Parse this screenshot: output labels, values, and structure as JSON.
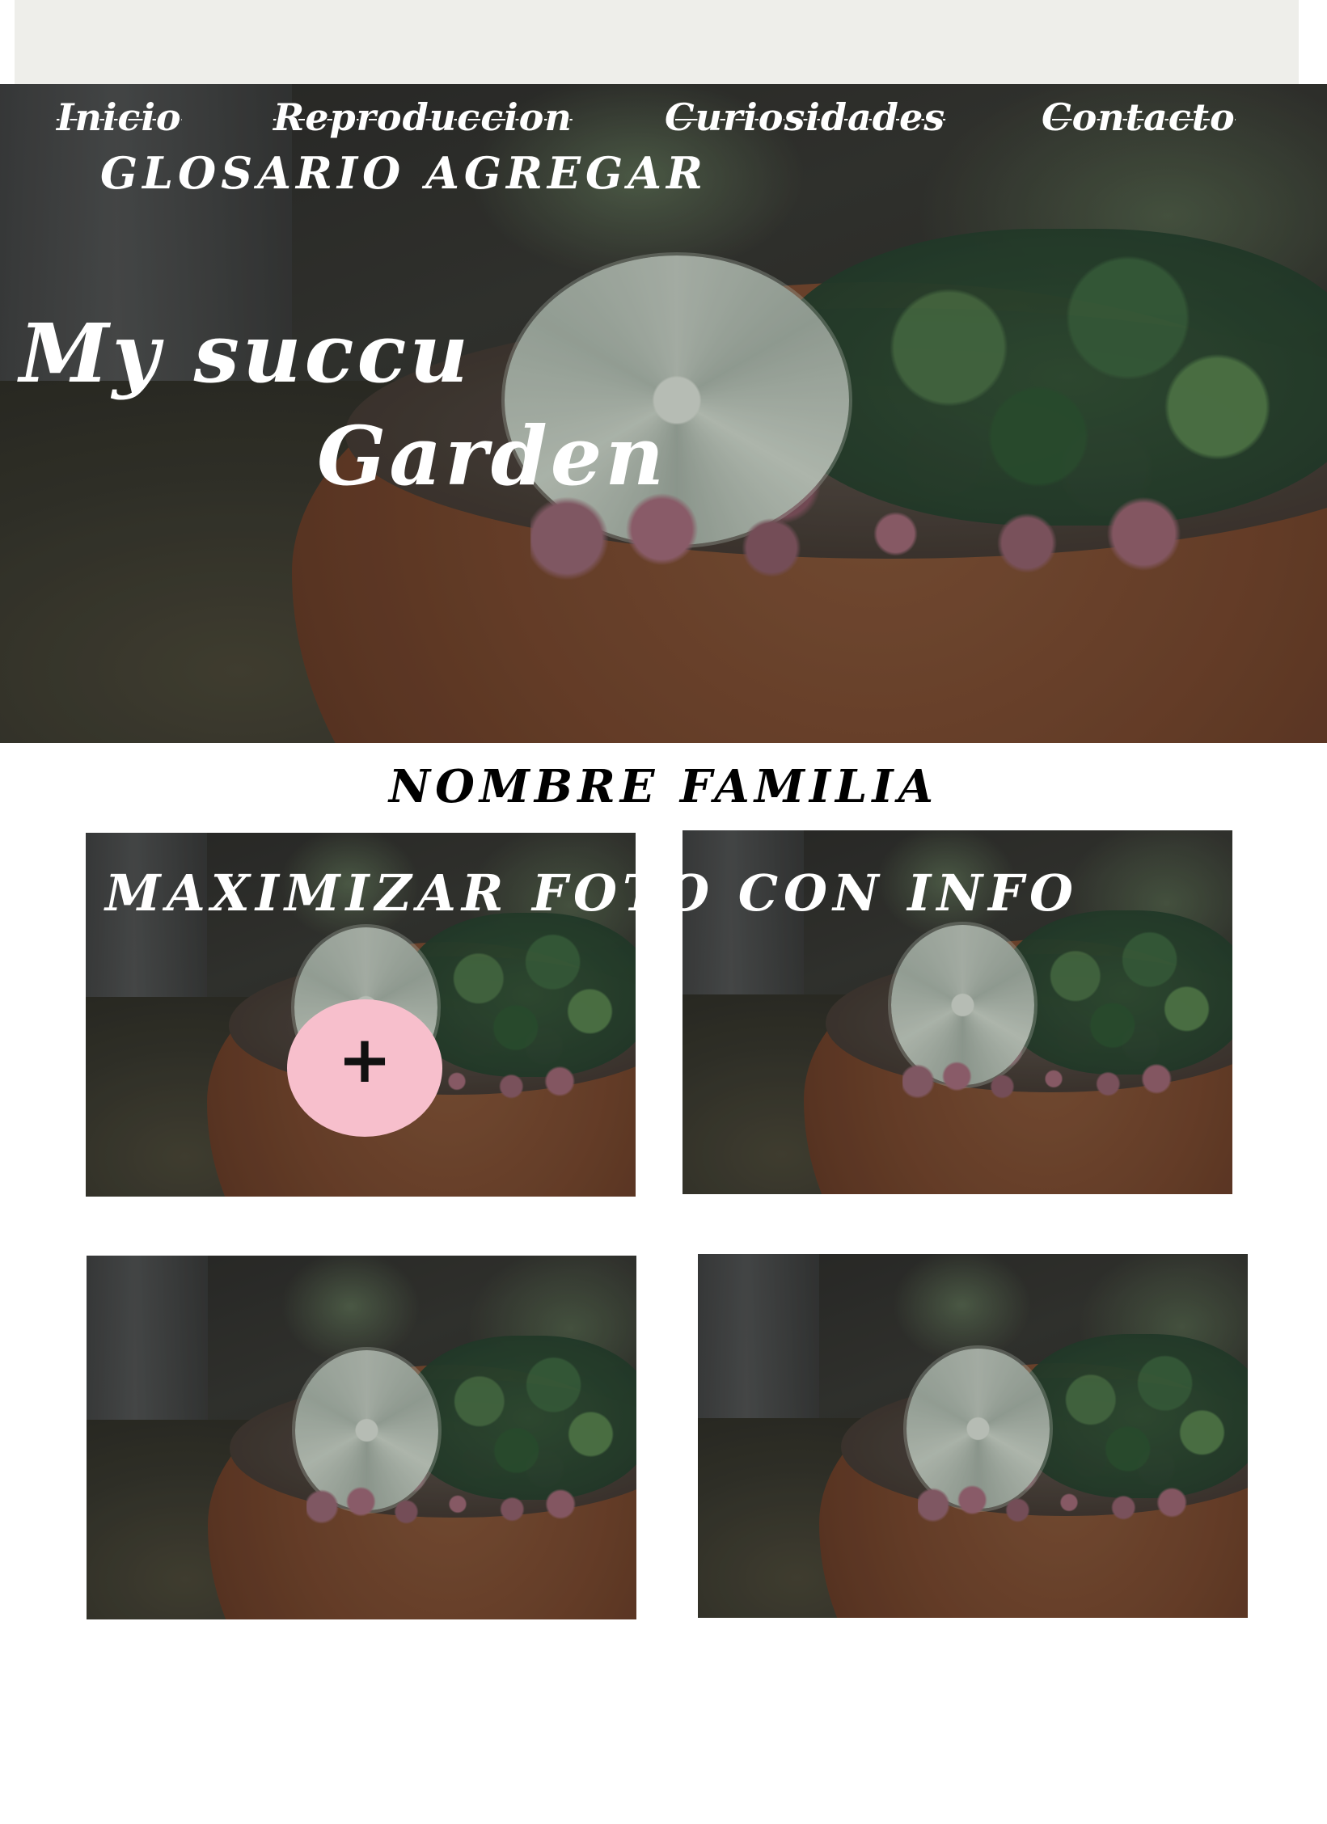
{
  "nav": {
    "items": [
      {
        "label": "Inicio"
      },
      {
        "label": "Reproduccion"
      },
      {
        "label": "Curiosidades"
      },
      {
        "label": "Contacto"
      }
    ],
    "secondary": "GLOSARIO AGREGAR"
  },
  "hero": {
    "title_line1": "My succu",
    "title_line2": "Garden"
  },
  "section": {
    "title": "NOMBRE FAMILIA"
  },
  "gallery": {
    "overlay_caption": "MAXIMIZAR FOTO CON INFO",
    "add_label": "+"
  },
  "colors": {
    "top_strip": "#eeeeea",
    "plus_button": "#f7bfcc",
    "text_on_image": "#ffffff",
    "section_title": "#000000"
  }
}
